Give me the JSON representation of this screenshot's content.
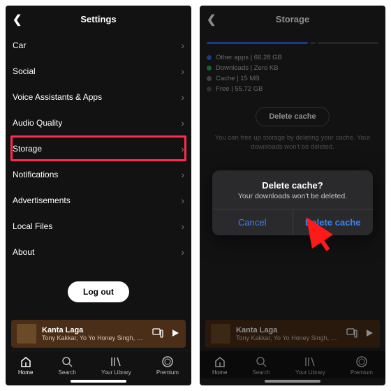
{
  "left": {
    "title": "Settings",
    "items": [
      {
        "label": "Car"
      },
      {
        "label": "Social"
      },
      {
        "label": "Voice Assistants & Apps"
      },
      {
        "label": "Audio Quality"
      },
      {
        "label": "Storage",
        "highlight": true
      },
      {
        "label": "Notifications"
      },
      {
        "label": "Advertisements"
      },
      {
        "label": "Local Files"
      },
      {
        "label": "About"
      }
    ],
    "logout": "Log out"
  },
  "right": {
    "title": "Storage",
    "bars": [
      {
        "color": "#2d6cff",
        "flex": 60
      },
      {
        "color": "#444",
        "flex": 3
      },
      {
        "color": "#444",
        "flex": 36
      }
    ],
    "legend": [
      {
        "color": "#2d6cff",
        "label": "Other apps",
        "value": "66.28 GB"
      },
      {
        "color": "#1db954",
        "label": "Downloads",
        "value": "Zero KB"
      },
      {
        "color": "#777",
        "label": "Cache",
        "value": "15 MB"
      },
      {
        "color": "#555",
        "label": "Free",
        "value": "55.72 GB"
      }
    ],
    "delete_btn": "Delete cache",
    "hint": "You can free up storage by deleting your cache. Your downloads won't be deleted.",
    "modal": {
      "title": "Delete cache?",
      "sub": "Your downloads won't be deleted.",
      "cancel": "Cancel",
      "confirm": "Delete cache"
    }
  },
  "np": {
    "title": "Kanta Laga",
    "subtitle": "Tony Kakkar, Yo Yo Honey Singh, Neha Ka"
  },
  "tabs": [
    {
      "label": "Home"
    },
    {
      "label": "Search"
    },
    {
      "label": "Your Library"
    },
    {
      "label": "Premium"
    }
  ]
}
